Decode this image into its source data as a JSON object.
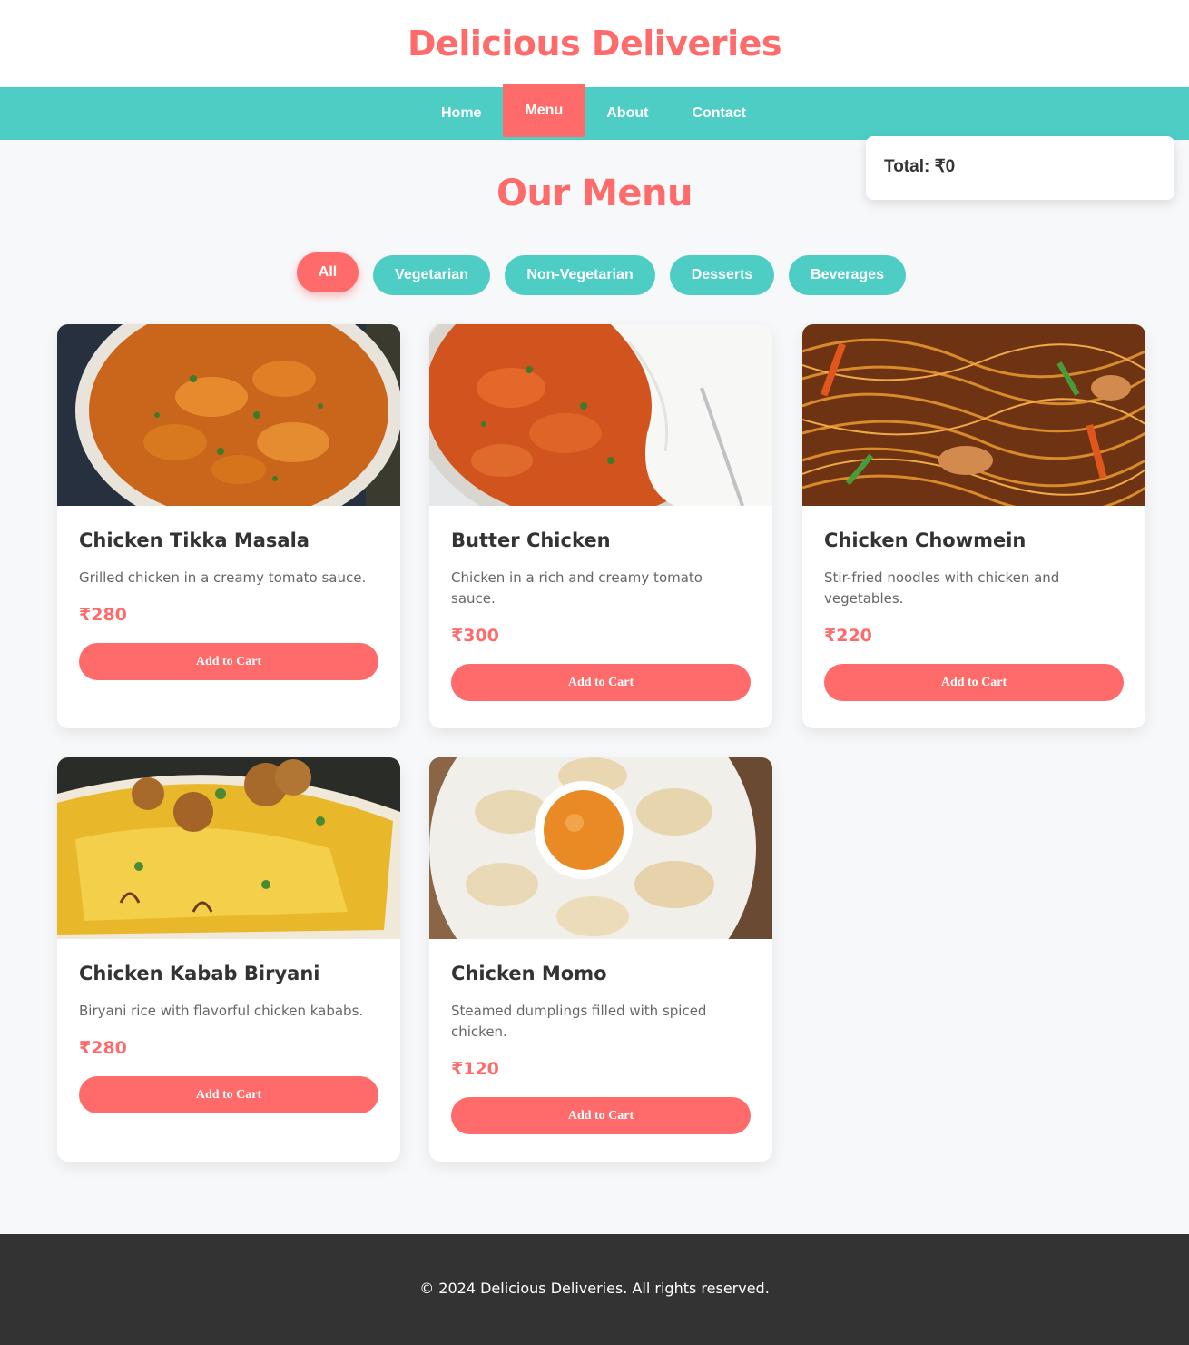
{
  "header": {
    "title": "Delicious Deliveries"
  },
  "nav": {
    "items": [
      "Home",
      "Menu",
      "About",
      "Contact"
    ],
    "active": "Menu"
  },
  "cart": {
    "total_label": "Total: ₹0"
  },
  "menu": {
    "title": "Our Menu",
    "filters": [
      "All",
      "Vegetarian",
      "Non-Vegetarian",
      "Desserts",
      "Beverages"
    ],
    "active_filter": "All",
    "items": [
      {
        "name": "Chicken Tikka Masala",
        "description": "Grilled chicken in a creamy tomato sauce.",
        "price": "₹280",
        "button": "Add to Cart",
        "image": "chicken-tikka-masala-image"
      },
      {
        "name": "Butter Chicken",
        "description": "Chicken in a rich and creamy tomato sauce.",
        "price": "₹300",
        "button": "Add to Cart",
        "image": "butter-chicken-image"
      },
      {
        "name": "Chicken Chowmein",
        "description": "Stir-fried noodles with chicken and vegetables.",
        "price": "₹220",
        "button": "Add to Cart",
        "image": "chicken-chowmein-image"
      },
      {
        "name": "Chicken Kabab Biryani",
        "description": "Biryani rice with flavorful chicken kababs.",
        "price": "₹280",
        "button": "Add to Cart",
        "image": "chicken-kabab-biryani-image"
      },
      {
        "name": "Chicken Momo",
        "description": "Steamed dumplings filled with spiced chicken.",
        "price": "₹120",
        "button": "Add to Cart",
        "image": "chicken-momo-image"
      }
    ]
  },
  "footer": {
    "copyright": "© 2024 Delicious Deliveries. All rights reserved."
  },
  "colors": {
    "accent": "#ff6b6b",
    "teal": "#4ecdc4",
    "footer": "#333333",
    "background": "#f7f8fa"
  }
}
